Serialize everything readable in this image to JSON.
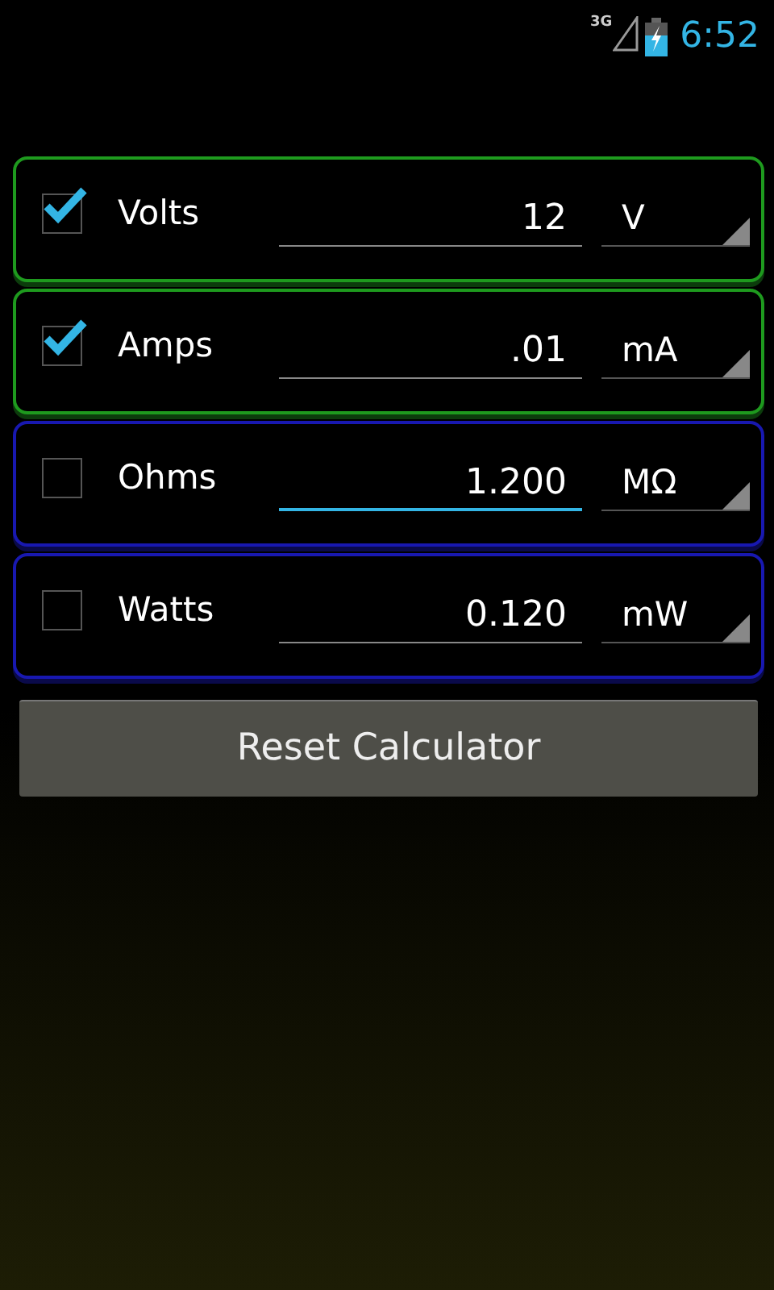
{
  "status_bar": {
    "network": "3G",
    "time": "6:52"
  },
  "rows": [
    {
      "label": "Volts",
      "checked": true,
      "value": "12",
      "unit": "V",
      "focused": false
    },
    {
      "label": "Amps",
      "checked": true,
      "value": ".01",
      "unit": "mA",
      "focused": false
    },
    {
      "label": "Ohms",
      "checked": false,
      "value": "1.200",
      "unit": "MΩ",
      "focused": true
    },
    {
      "label": "Watts",
      "checked": false,
      "value": "0.120",
      "unit": "mW",
      "focused": false
    }
  ],
  "reset_button": "Reset Calculator"
}
